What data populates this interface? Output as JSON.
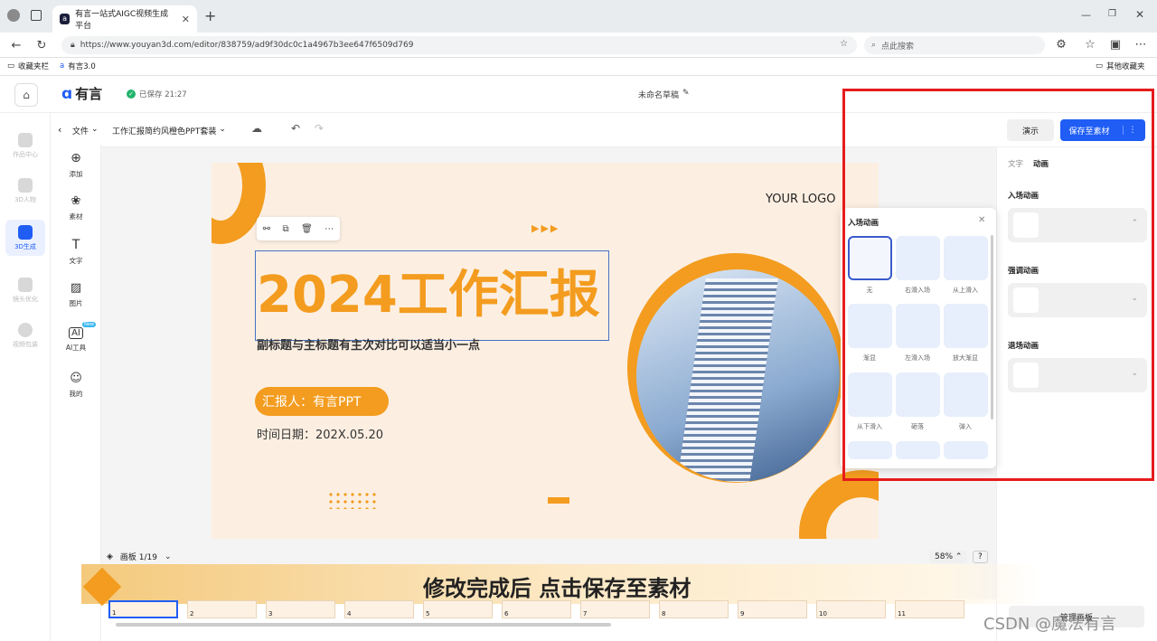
{
  "browser": {
    "tab_title": "有言一站式AIGC视频生成平台",
    "url": "https://www.youyan3d.com/editor/838759/ad9f30dc0c1a4967b3ee647f6509d769",
    "search_placeholder": "点此搜索",
    "bookmarks": [
      "收藏夹栏",
      "有言3.0"
    ],
    "other_bookmarks": "其他收藏夹"
  },
  "app": {
    "logo": "有言",
    "save_status": "已保存 21:27",
    "doc_name": "未命名草稿"
  },
  "left_nav": [
    "作品中心",
    "3D人物",
    "3D生成",
    "镜头优化",
    "视频包装"
  ],
  "tools": [
    "添加",
    "素材",
    "文字",
    "图片",
    "AI工具",
    "我的"
  ],
  "tool_badge": "New",
  "toolbar": {
    "file_menu": "文件",
    "template_name": "工作汇报简约风橙色PPT套装",
    "present": "演示",
    "save_to_material": "保存至素材"
  },
  "slide": {
    "logo": "YOUR LOGO",
    "title": "2024工作汇报",
    "subtitle": "副标题与主标题有主次对比可以适当小一点",
    "reporter": "汇报人：有言PPT",
    "date": "时间日期：202X.05.20",
    "arrows": "▶▶▶"
  },
  "popup": {
    "title": "入场动画",
    "items": [
      "无",
      "右滑入场",
      "从上滑入",
      "渐显",
      "左滑入场",
      "放大渐显",
      "从下滑入",
      "砸落",
      "弹入"
    ]
  },
  "right_panel": {
    "tabs": [
      "文字",
      "动画"
    ],
    "sections": [
      "入场动画",
      "强调动画",
      "退场动画"
    ]
  },
  "bottom": {
    "board": "画板 1/19",
    "zoom": "58%",
    "help": "?",
    "banner_text": "修改完成后 点击保存至素材",
    "thumb_numbers": [
      "1",
      "2",
      "3",
      "4",
      "5",
      "6",
      "7",
      "8",
      "9",
      "10",
      "11"
    ],
    "manage": "管理画板",
    "watermark": "CSDN @魔法有言"
  },
  "colors": {
    "accent_orange": "#f39c1f",
    "primary_blue": "#1f5df5",
    "highlight_red": "#e61c1c"
  }
}
